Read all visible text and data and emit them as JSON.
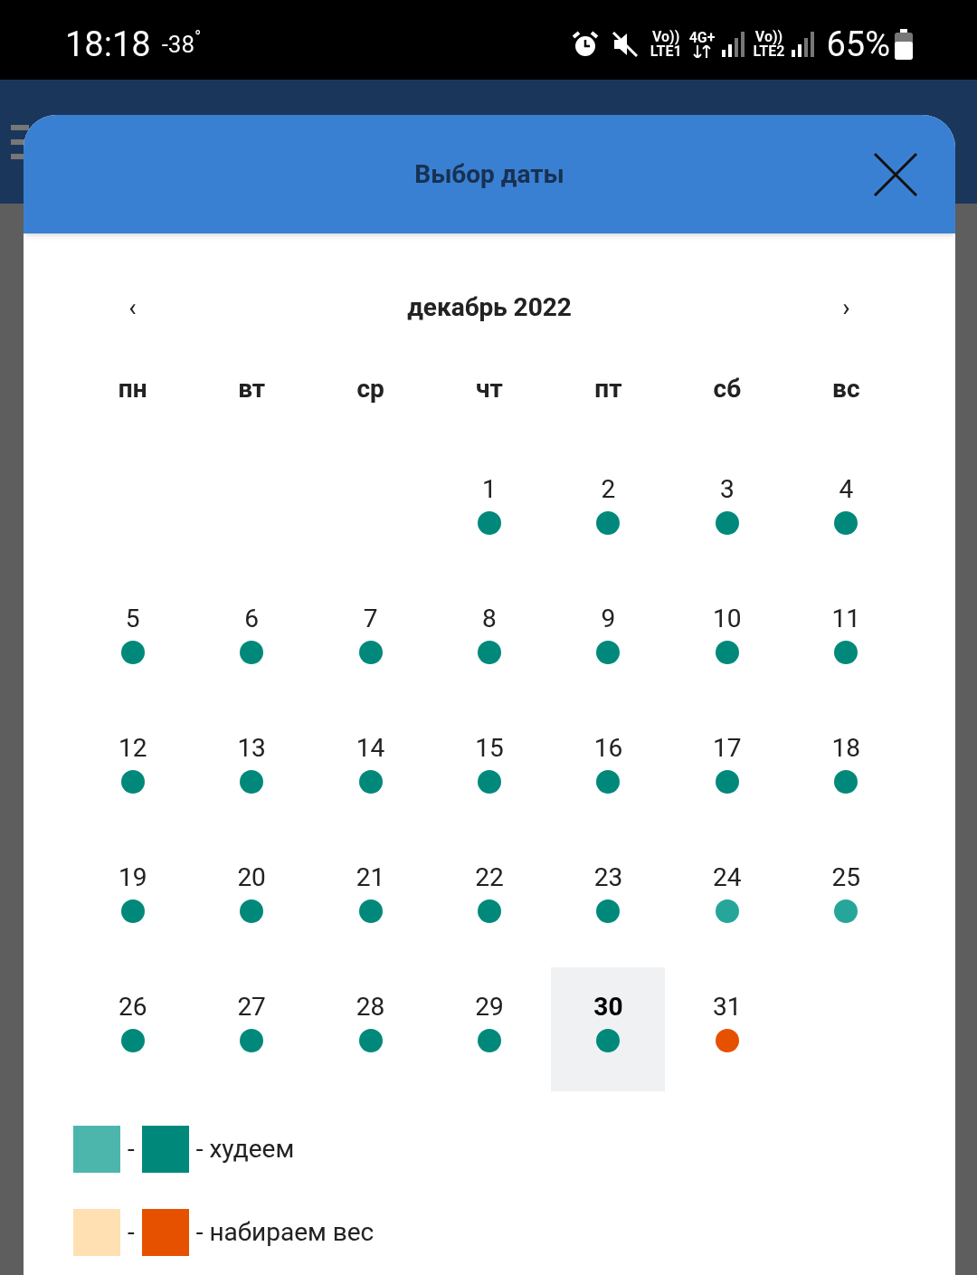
{
  "status_bar": {
    "time": "18:18",
    "temperature": "-38$^{°}$",
    "sims": [
      {
        "top": "Vo))",
        "bottom": "LTE1"
      },
      {
        "top": "Vo))",
        "bottom": "LTE2"
      }
    ],
    "network": "4G+",
    "battery": "65%"
  },
  "dialog": {
    "title": "Выбор даты",
    "month": "декабрь 2022",
    "prev": "‹",
    "next": "›",
    "weekdays": [
      "пн",
      "вт",
      "ср",
      "чт",
      "пт",
      "сб",
      "вс"
    ],
    "weeks": [
      [
        {
          "day": "1",
          "color": "#00897b",
          "selected": false
        },
        {
          "day": "2",
          "color": "#00897b",
          "selected": false
        },
        {
          "day": "3",
          "color": "#00897b",
          "selected": false
        },
        {
          "day": "4",
          "color": "#00897b",
          "selected": false
        }
      ],
      [
        {
          "day": "5",
          "color": "#00897b",
          "selected": false
        },
        {
          "day": "6",
          "color": "#00897b",
          "selected": false
        },
        {
          "day": "7",
          "color": "#00897b",
          "selected": false
        },
        {
          "day": "8",
          "color": "#00897b",
          "selected": false
        },
        {
          "day": "9",
          "color": "#00897b",
          "selected": false
        },
        {
          "day": "10",
          "color": "#00897b",
          "selected": false
        },
        {
          "day": "11",
          "color": "#00897b",
          "selected": false
        }
      ],
      [
        {
          "day": "12",
          "color": "#00897b",
          "selected": false
        },
        {
          "day": "13",
          "color": "#00897b",
          "selected": false
        },
        {
          "day": "14",
          "color": "#00897b",
          "selected": false
        },
        {
          "day": "15",
          "color": "#00897b",
          "selected": false
        },
        {
          "day": "16",
          "color": "#00897b",
          "selected": false
        },
        {
          "day": "17",
          "color": "#00897b",
          "selected": false
        },
        {
          "day": "18",
          "color": "#00897b",
          "selected": false
        }
      ],
      [
        {
          "day": "19",
          "color": "#00897b",
          "selected": false
        },
        {
          "day": "20",
          "color": "#00897b",
          "selected": false
        },
        {
          "day": "21",
          "color": "#00897b",
          "selected": false
        },
        {
          "day": "22",
          "color": "#00897b",
          "selected": false
        },
        {
          "day": "23",
          "color": "#00897b",
          "selected": false
        },
        {
          "day": "24",
          "color": "#26a69a",
          "selected": false
        },
        {
          "day": "25",
          "color": "#26a69a",
          "selected": false
        }
      ],
      [
        {
          "day": "26",
          "color": "#00897b",
          "selected": false
        },
        {
          "day": "27",
          "color": "#00897b",
          "selected": false
        },
        {
          "day": "28",
          "color": "#00897b",
          "selected": false
        },
        {
          "day": "29",
          "color": "#00897b",
          "selected": false
        },
        {
          "day": "30",
          "color": "#00897b",
          "selected": true
        },
        {
          "day": "31",
          "color": "#e65100",
          "selected": false
        }
      ]
    ],
    "legend": [
      {
        "swatches": [
          {
            "color": "#4db6ac"
          },
          {
            "color": "#00897b"
          }
        ],
        "separator": "-",
        "label": "- худеем"
      },
      {
        "swatches": [
          {
            "color": "#ffe0b2"
          },
          {
            "color": "#e65100"
          }
        ],
        "separator": "-",
        "label": "- набираем вес"
      }
    ]
  }
}
